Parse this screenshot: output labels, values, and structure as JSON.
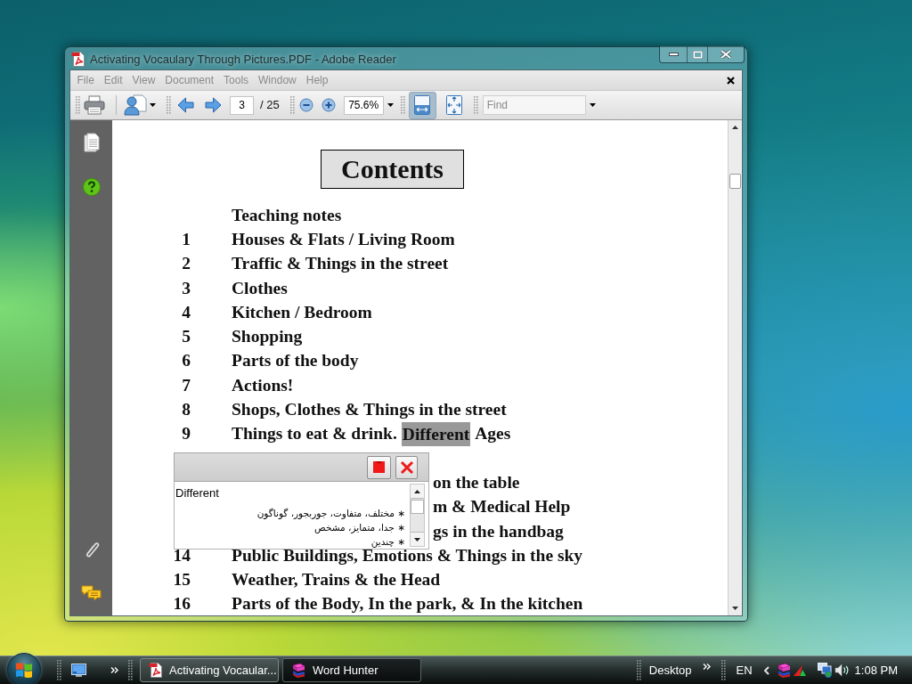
{
  "window": {
    "title": "Activating Vocaulary Through Pictures.PDF - Adobe Reader",
    "menu": [
      "File",
      "Edit",
      "View",
      "Document",
      "Tools",
      "Window",
      "Help"
    ]
  },
  "toolbar": {
    "page_field": {
      "value": "3"
    },
    "page_total": "/ 25",
    "zoom_field": {
      "value": "75.6%"
    },
    "view_buttons": [
      {
        "kind": "fit_width",
        "selected": true
      },
      {
        "kind": "fit_page",
        "selected": false
      }
    ],
    "find_field": {
      "placeholder": "Find"
    }
  },
  "document": {
    "heading": "Contents",
    "entries": [
      {
        "kind": "entry",
        "title": "Teaching notes"
      },
      {
        "kind": "entry",
        "number": "1",
        "title": "Houses & Flats / Living Room"
      },
      {
        "kind": "entry",
        "number": "2",
        "title": "Traffic & Things in the street"
      },
      {
        "kind": "entry",
        "number": "3",
        "title": "Clothes"
      },
      {
        "kind": "entry",
        "number": "4",
        "title": "Kitchen / Bedroom"
      },
      {
        "kind": "entry",
        "number": "5",
        "title": "Shopping"
      },
      {
        "kind": "entry",
        "number": "6",
        "title": "Parts of the body"
      },
      {
        "kind": "entry",
        "number": "7",
        "title": "Actions!"
      },
      {
        "kind": "entry",
        "number": "8",
        "title": "Shops, Clothes & Things in the street"
      },
      {
        "kind": "entry",
        "number": "9",
        "segments": [
          {
            "text": "Things to eat & drink.",
            "selected": false
          },
          {
            "text": "Different",
            "selected": true
          },
          {
            "text": "Ages",
            "selected": false
          }
        ]
      },
      {
        "kind": "covered",
        "title": "on the table"
      },
      {
        "kind": "covered",
        "title": "m & Medical Help"
      },
      {
        "kind": "covered",
        "title": "gs in the handbag"
      },
      {
        "kind": "entry",
        "number": "14",
        "title": "Public Buildings, Emotions & Things in the sky"
      },
      {
        "kind": "entry",
        "number": "15",
        "title": "Weather, Trains & the Head"
      },
      {
        "kind": "entry",
        "number": "16",
        "title": "Parts of the Body, In the park, & In the kitchen"
      }
    ]
  },
  "popup": {
    "word": "Different",
    "meanings": [
      "∗ مختلف، متفاوت، جوربجور، گوناگون",
      "∗ جدا، متمایز، مشخص",
      "∗ چندین"
    ]
  },
  "taskbar": {
    "buttons": [
      {
        "kind": "pdf",
        "label": "Activating Vocaular...",
        "selected": false
      },
      {
        "kind": "books",
        "label": "Word Hunter",
        "selected": true
      }
    ],
    "toolbar_label": "Desktop",
    "language": "EN",
    "clock": "1:08 PM"
  }
}
